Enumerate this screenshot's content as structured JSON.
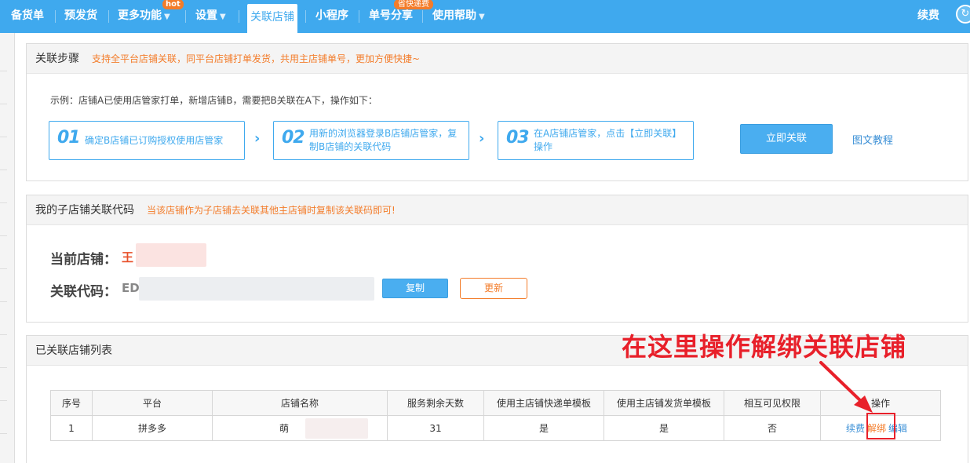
{
  "nav": {
    "items": [
      {
        "label": "备货单",
        "arrow": ""
      },
      {
        "label": "预发货",
        "arrow": ""
      },
      {
        "label": "更多功能",
        "arrow": "▼",
        "badge": "hot"
      },
      {
        "label": "设置",
        "arrow": "▼"
      },
      {
        "label": "关联店铺",
        "active": true
      },
      {
        "label": "小程序",
        "arrow": ""
      },
      {
        "label": "单号分享",
        "arrow": "",
        "badge": "省快递费"
      },
      {
        "label": "使用帮助",
        "arrow": "▼"
      }
    ],
    "renew": "续费"
  },
  "steps_panel": {
    "title": "关联步骤",
    "hint": "支持全平台店铺关联，同平台店铺打单发货，共用主店铺单号，更加方便快捷~",
    "example": "示例：店铺A已使用店管家打单，新增店铺B，需要把B关联在A下，操作如下：",
    "steps": [
      {
        "num": "01",
        "text": "确定B店铺已订购授权使用店管家"
      },
      {
        "num": "02",
        "text": "用新的浏览器登录B店铺店管家，复制B店铺的关联代码"
      },
      {
        "num": "03",
        "text": "在A店铺店管家，点击【立即关联】操作"
      }
    ],
    "link_button": "立即关联",
    "tutorial": "图文教程"
  },
  "code_panel": {
    "title": "我的子店铺关联代码",
    "hint": "当该店铺作为子店铺去关联其他主店铺时复制该关联码即可!",
    "current_store_label": "当前店铺：",
    "current_store_value": "王",
    "code_label": "关联代码：",
    "code_value": "ED",
    "copy_button": "复制",
    "update_button": "更新"
  },
  "list_panel": {
    "title": "已关联店铺列表",
    "columns": [
      "序号",
      "平台",
      "店铺名称",
      "服务剩余天数",
      "使用主店铺快递单模板",
      "使用主店铺发货单模板",
      "相互可见权限",
      "操作"
    ],
    "rows": [
      {
        "index": "1",
        "platform": "拼多多",
        "store": "萌",
        "days": "31",
        "express_tpl": "是",
        "ship_tpl": "是",
        "visible": "否",
        "renew": "续费",
        "unbind": "解绑",
        "edit": "编辑"
      }
    ]
  },
  "annotation": "在这里操作解绑关联店铺",
  "colors": {
    "primary": "#3fa9ee",
    "accent": "#f37c2a",
    "annotation": "#e8202a"
  }
}
